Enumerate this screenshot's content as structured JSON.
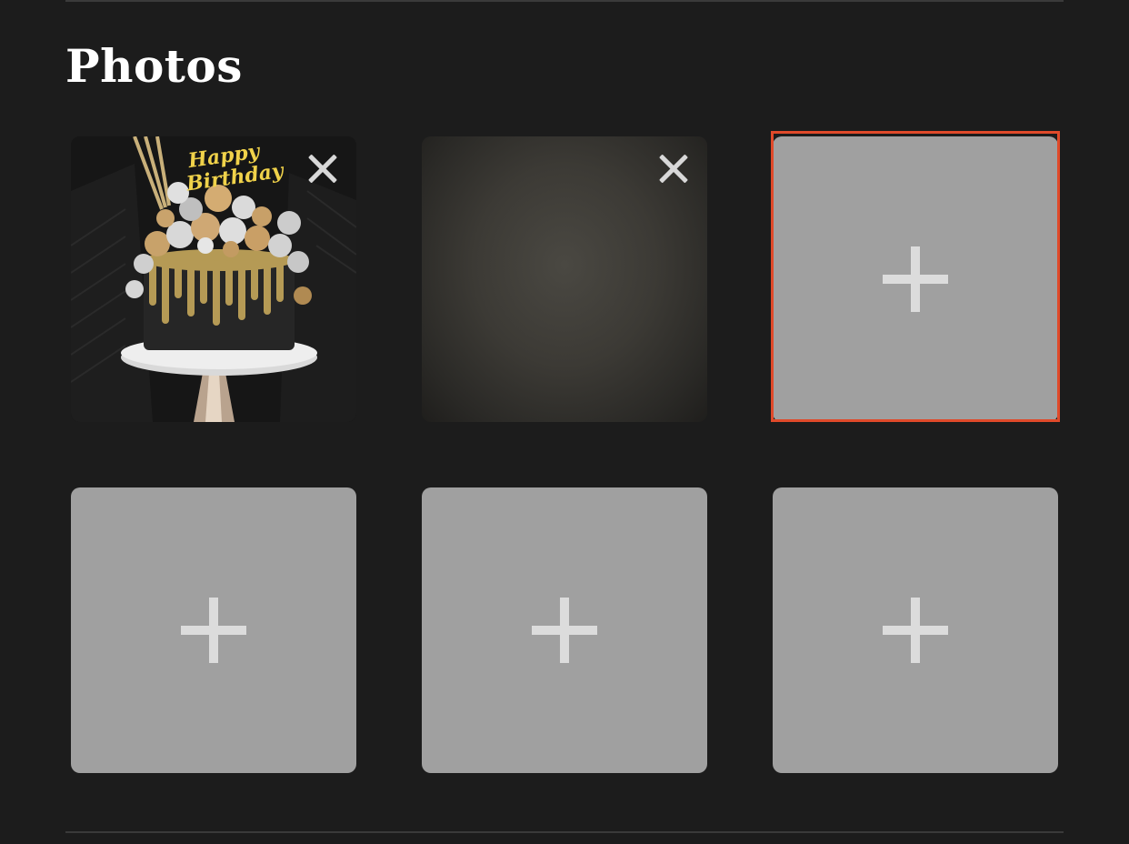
{
  "section": {
    "title": "Photos"
  },
  "photos": [
    {
      "state": "filled",
      "image": "birthday-cake-photo",
      "topper_text": "Happy Birthday",
      "remove_icon": "close-icon"
    },
    {
      "state": "filled",
      "image": "dark-texture-photo",
      "remove_icon": "close-icon"
    },
    {
      "state": "empty",
      "add_icon": "plus-icon",
      "selected": true
    },
    {
      "state": "empty",
      "add_icon": "plus-icon"
    },
    {
      "state": "empty",
      "add_icon": "plus-icon"
    },
    {
      "state": "empty",
      "add_icon": "plus-icon"
    }
  ],
  "colors": {
    "background": "#1c1c1c",
    "empty_slot": "#a0a0a0",
    "plus": "#dcdcdc",
    "selection_outline": "#e04a2a",
    "title": "#ffffff"
  }
}
